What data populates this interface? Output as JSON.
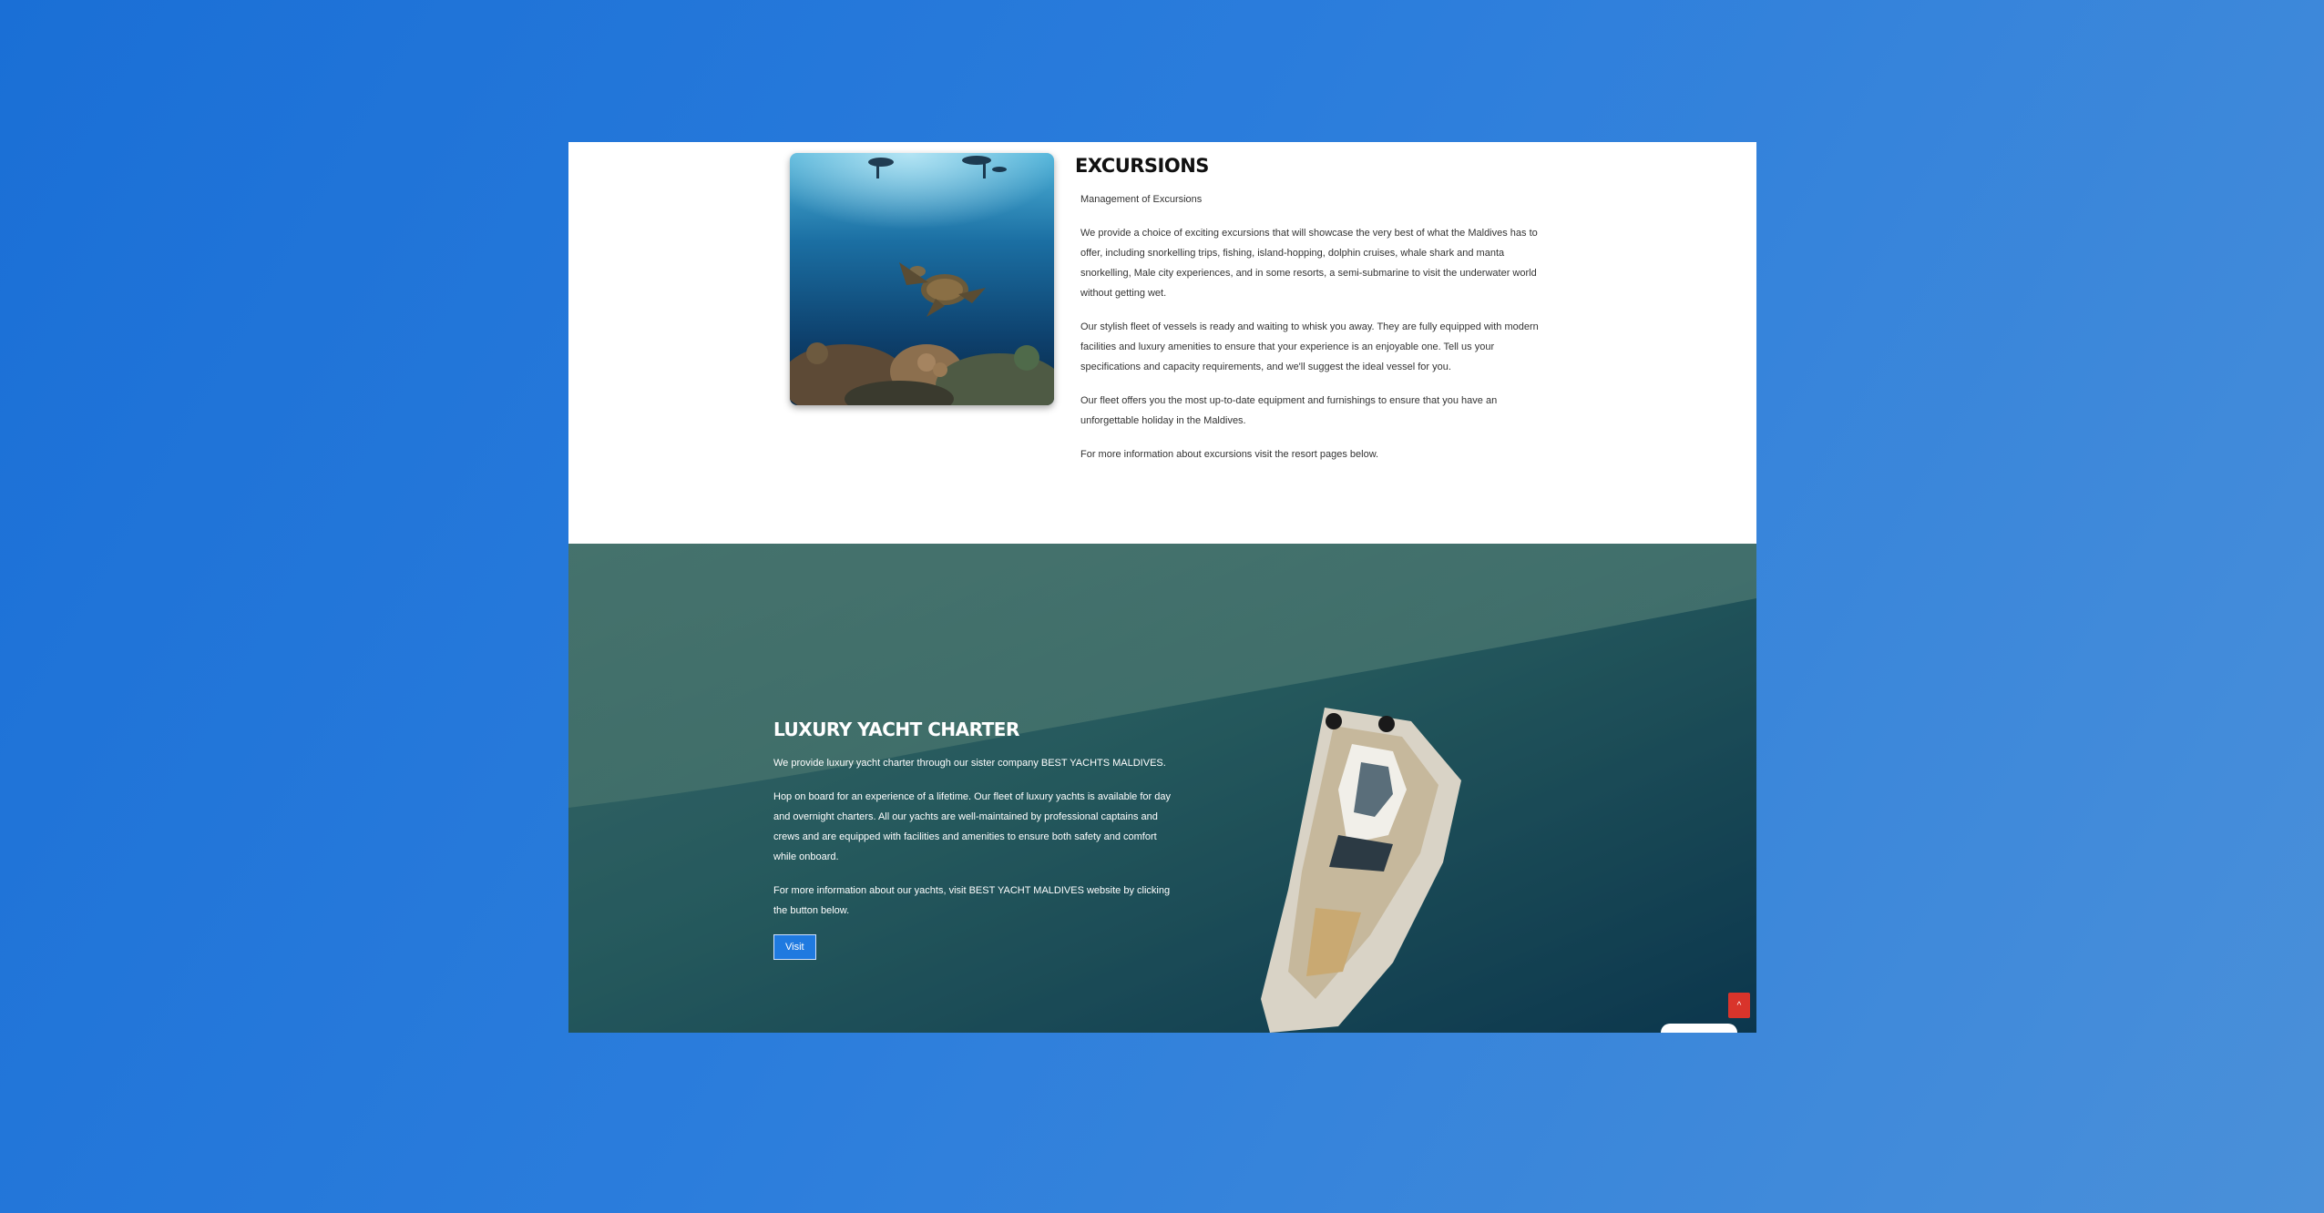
{
  "excursions": {
    "title": "EXCURSIONS",
    "subtitle": "Management of Excursions",
    "paragraphs": [
      "We provide a choice of exciting excursions that will showcase the very best of what the Maldives has to offer, including snorkelling trips, fishing, island-hopping, dolphin cruises, whale shark and manta snorkelling, Male city experiences, and in some resorts, a semi-submarine to visit the underwater world without getting wet.",
      "Our stylish fleet of vessels is ready and waiting to whisk you away. They are fully equipped with modern facilities and luxury amenities to ensure that your experience is an enjoyable one. Tell us your specifications and capacity requirements, and we'll suggest the ideal vessel for you.",
      "Our fleet offers you the most up-to-date equipment and furnishings to ensure that you have an unforgettable holiday in the Maldives.",
      "For more information about excursions visit the resort pages below."
    ]
  },
  "yacht": {
    "title": "LUXURY YACHT CHARTER",
    "paragraphs": [
      "We provide luxury yacht charter through our sister company BEST YACHTS MALDIVES.",
      "Hop on board for an experience of a lifetime. Our fleet of luxury yachts is available for day and overnight charters. All our yachts are well-maintained by professional captains and crews and are equipped with facilities and amenities to ensure both safety and comfort while onboard.",
      "For more information about our yachts, visit BEST YACHT MALDIVES website by clicking the button below."
    ],
    "visit_label": "Visit"
  },
  "widgets": {
    "scroll_top_icon": "chevron-up-icon",
    "scroll_top_glyph": "^"
  },
  "colors": {
    "accent": "#1f7ae0",
    "scroll_top": "#d9342b",
    "page_background": "#1a6fd6"
  }
}
